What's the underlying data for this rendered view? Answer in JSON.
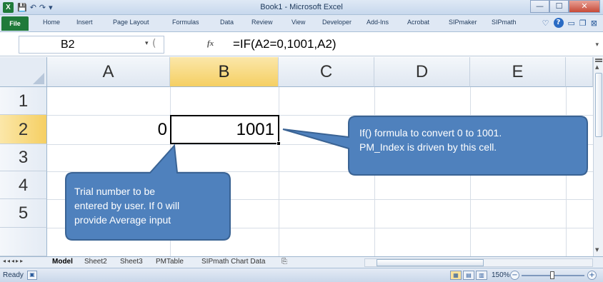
{
  "window": {
    "title": "Book1 - Microsoft Excel",
    "app_icon": "X",
    "controls": {
      "minimize": "—",
      "maximize": "☐",
      "close": "✕"
    }
  },
  "ribbon": {
    "file_label": "File",
    "tabs": [
      "Home",
      "Insert",
      "Page Layout",
      "Formulas",
      "Data",
      "Review",
      "View",
      "Developer",
      "Add-Ins",
      "Acrobat",
      "SIPmaker",
      "SIPmath"
    ]
  },
  "formula_bar": {
    "name_box": "B2",
    "fx_label": "fx",
    "formula": "=IF(A2=0,1001,A2)"
  },
  "grid": {
    "columns": [
      "A",
      "B",
      "C",
      "D",
      "E"
    ],
    "rows": [
      "1",
      "2",
      "3",
      "4",
      "5"
    ],
    "selected_column": "B",
    "selected_row": "2",
    "cells": {
      "A2": "0",
      "B2": "1001"
    }
  },
  "callouts": [
    {
      "lines": [
        "If() formula to convert 0 to 1001.",
        "PM_Index is driven by this cell."
      ]
    },
    {
      "lines": [
        "Trial number to be",
        "entered by user. If 0 will",
        "provide  Average input"
      ]
    }
  ],
  "sheets": [
    "Model",
    "Sheet2",
    "Sheet3",
    "PMTable",
    "SIPmath Chart Data"
  ],
  "active_sheet": "Model",
  "status": {
    "ready": "Ready",
    "zoom": "150%"
  },
  "colors": {
    "callout_fill": "#4f81bd",
    "callout_stroke": "#3a6394",
    "selected_header": "#f5cf63",
    "file_tab": "#1f7a3a"
  }
}
